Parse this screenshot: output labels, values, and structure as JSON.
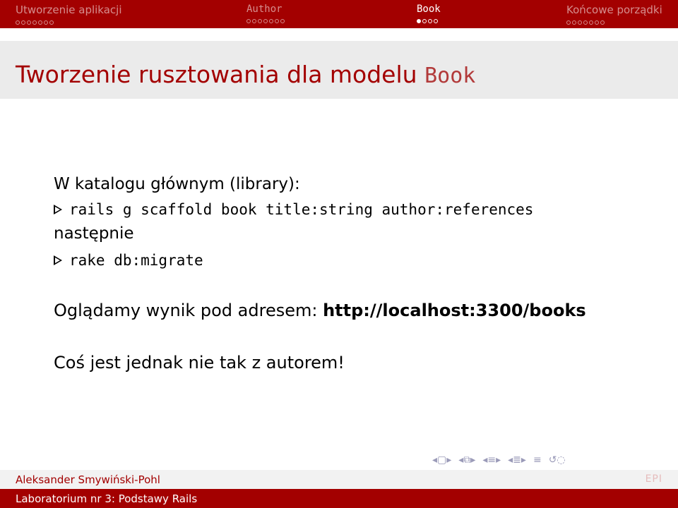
{
  "nav": {
    "sections": [
      {
        "title": "Utworzenie aplikacji",
        "mono": false,
        "dots": 7,
        "filled": -1,
        "active": false
      },
      {
        "title": "Author",
        "mono": true,
        "dots": 7,
        "filled": -1,
        "active": false
      },
      {
        "title": "Book",
        "mono": true,
        "dots": 4,
        "filled": 0,
        "active": true
      },
      {
        "title": "Końcowe porządki",
        "mono": false,
        "dots": 7,
        "filled": -1,
        "active": false
      }
    ]
  },
  "frame": {
    "title_text": "Tworzenie rusztowania dla modelu",
    "title_code": "Book"
  },
  "content": {
    "intro": "W katalogu głównym (library):",
    "cmd1": "rails g scaffold book title:string author:references",
    "then": "następnie",
    "cmd2": "rake db:migrate",
    "view_text": "Oglądamy wynik pod adresem:",
    "view_url": "http://localhost:3300/books",
    "issue": "Coś jest jednak nie tak z autorem!"
  },
  "footer": {
    "author": "Aleksander Smywiński-Pohl",
    "subtitle": "Laboratorium nr 3: Podstawy Rails",
    "logo": "EPI"
  },
  "icons": [
    "frame-back-icon",
    "frame-forward-icon",
    "subsection-back-icon",
    "subsection-forward-icon",
    "section-back-icon",
    "section-forward-icon",
    "toc-icon",
    "search-icon"
  ],
  "colors": {
    "accent": "#a30000",
    "title_band": "#ebebeb"
  }
}
